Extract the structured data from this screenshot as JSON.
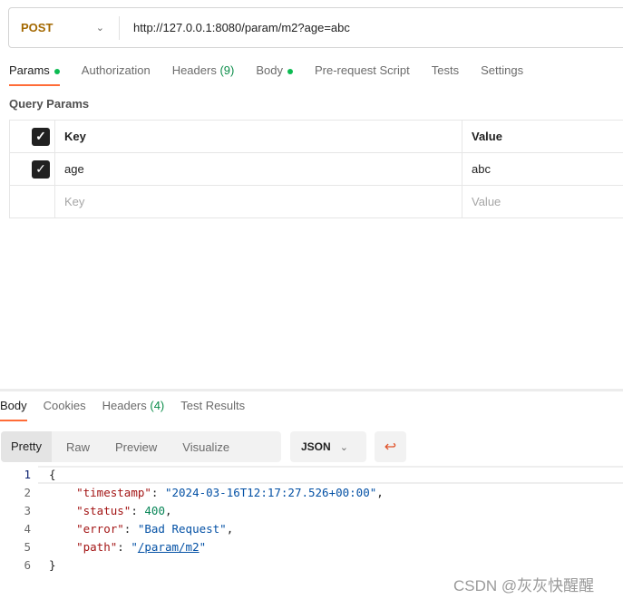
{
  "request": {
    "method": "POST",
    "url": "http://127.0.0.1:8080/param/m2?age=abc"
  },
  "tabs": [
    {
      "label": "Params",
      "dot": true
    },
    {
      "label": "Authorization"
    },
    {
      "label": "Headers",
      "count": "(9)"
    },
    {
      "label": "Body",
      "dot": true
    },
    {
      "label": "Pre-request Script"
    },
    {
      "label": "Tests"
    },
    {
      "label": "Settings"
    }
  ],
  "query_params": {
    "title": "Query Params",
    "headers": {
      "key": "Key",
      "value": "Value"
    },
    "rows": [
      {
        "checked": true,
        "key": "age",
        "value": "abc"
      }
    ],
    "placeholder": {
      "key": "Key",
      "value": "Value"
    }
  },
  "response": {
    "tabs": [
      {
        "label": "Body"
      },
      {
        "label": "Cookies"
      },
      {
        "label": "Headers",
        "count": "(4)"
      },
      {
        "label": "Test Results"
      }
    ],
    "views": [
      "Pretty",
      "Raw",
      "Preview",
      "Visualize"
    ],
    "format": "JSON",
    "lines": [
      "1",
      "2",
      "3",
      "4",
      "5",
      "6"
    ],
    "json": {
      "open": "{",
      "close": "}",
      "timestamp_key": "\"timestamp\"",
      "timestamp_val": "\"2024-03-16T12:17:27.526+00:00\"",
      "status_key": "\"status\"",
      "status_val": "400",
      "error_key": "\"error\"",
      "error_val": "\"Bad Request\"",
      "path_key": "\"path\"",
      "path_val": "/param/m2"
    }
  },
  "watermark": "CSDN @灰灰快醒醒",
  "colors": {
    "accent": "#ff6c37",
    "method": "#a36800",
    "dot": "#0cbb52"
  }
}
